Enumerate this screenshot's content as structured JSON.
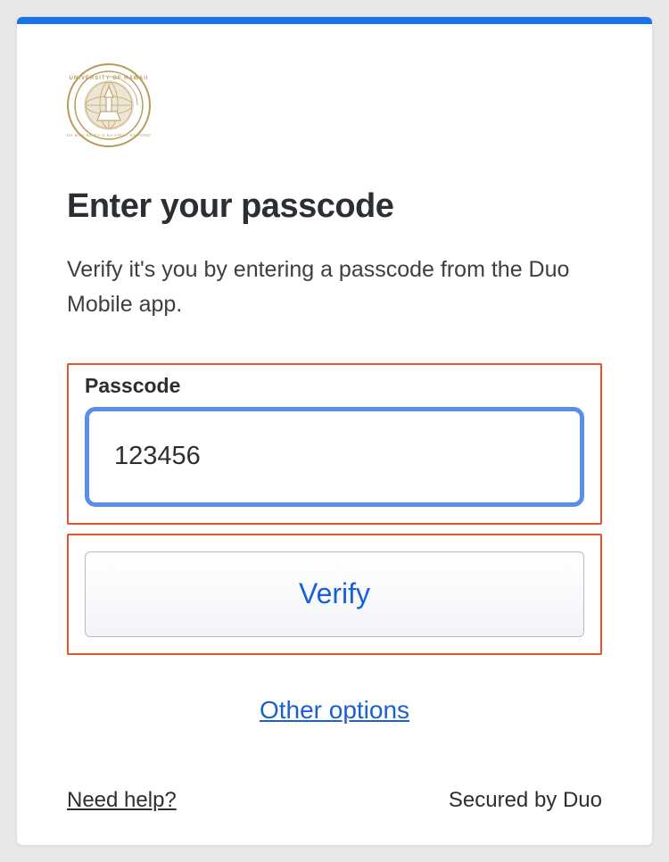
{
  "logo": {
    "alt": "University of Hawaii"
  },
  "heading": "Enter your passcode",
  "subtext": "Verify it's you by entering a passcode from the Duo Mobile app.",
  "passcode": {
    "label": "Passcode",
    "value": "123456"
  },
  "verify_label": "Verify",
  "other_options_label": "Other options",
  "help_label": "Need help?",
  "secured_label": "Secured by Duo"
}
